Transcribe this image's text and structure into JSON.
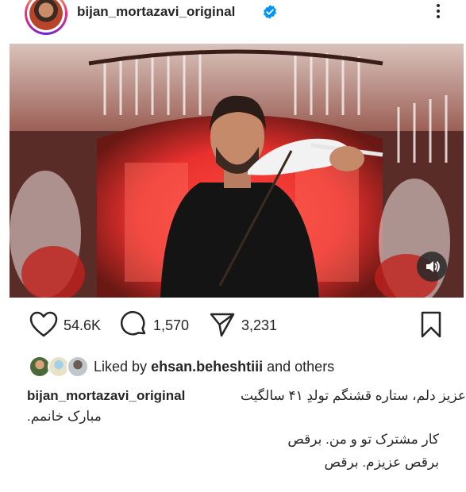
{
  "post": {
    "username": "bijan_mortazavi_original",
    "verified_icon": "verified-badge-icon",
    "menu_icon": "more-vertical-icon"
  },
  "media": {
    "type": "video",
    "sound_icon": "speaker-icon"
  },
  "actions": {
    "likes": "54.6K",
    "comments": "1,570",
    "shares": "3,231"
  },
  "liked_by": {
    "prefix": "Liked by",
    "user": "ehsan.beheshtiii",
    "suffix": "and others"
  },
  "caption": {
    "line1": "عزیز دلم، ستاره قشنگم تولدِ ۴۱ سالگیت",
    "line2": "مبارک خانمم.",
    "line3": "کار مشترک تو و من. برقص",
    "line4": "برقص عزیزم. برقص"
  },
  "colors": {
    "text": "#262626",
    "verified": "#0095f6",
    "scene_red": "#e8302e"
  }
}
